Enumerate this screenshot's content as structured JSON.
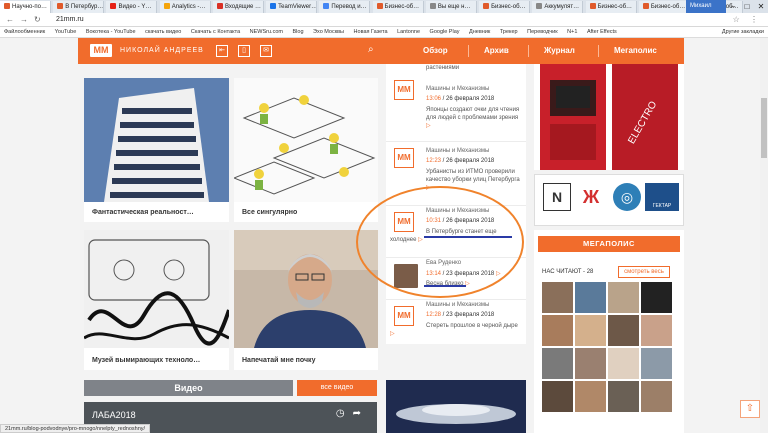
{
  "browser": {
    "tabs": [
      "Научно-по…",
      "В Петербур…",
      "Видео - Y…",
      "Analytics -…",
      "Входящие …",
      "TeamViewer…",
      "Перевод и…",
      "Бизнес-об…",
      "Вы еще н…",
      "Бизнес-об…",
      "Аккумулят…",
      "Бизнес-об…",
      "Бизнес-об…",
      "Бизнес-об…"
    ],
    "user": "Михаил",
    "url": "21mm.ru",
    "bookmarks": [
      "Файлообменник",
      "YouTube",
      "Вокотека - YouTube",
      "скачать видео",
      "Скачать с Контакта",
      "NEWSru.com",
      "Blog",
      "Эхо Москвы",
      "Новая Газета",
      "Lantonne",
      "Google Play",
      "Дневник",
      "Трекер",
      "Переводчик",
      "N+1",
      "After Effects"
    ],
    "other_bookmarks": "Другие закладки",
    "status": "21mm.ru/blog-podvodnye/pro-mnogo/nnelpty_rednoshny/"
  },
  "header": {
    "logo": "ММ",
    "author": "НИКОЛАЙ АНДРЕЕВ",
    "menu": [
      "Обзор",
      "Архив",
      "Журнал",
      "Мегаполис"
    ]
  },
  "cards": {
    "c1": "Фантастическая реальност…",
    "c2": "Все сингулярно",
    "c3": "Музей вымирающих техноло…",
    "c4": "Напечатай мне почку"
  },
  "feed": {
    "top_snip": "растениями",
    "items": [
      {
        "source": "Машины и Механизмы",
        "time": "13:06",
        "date": "26 февраля 2018",
        "title": "Японцы создают очки для чтения для людей с проблемами зрения"
      },
      {
        "source": "Машины и Механизмы",
        "time": "12:23",
        "date": "26 февраля 2018",
        "title": "Урбанисты из ИТМО проверили качество уборки улиц Петербурга"
      },
      {
        "source": "Машины и Механизмы",
        "time": "10:31",
        "date": "26 февраля 2018",
        "title": "В Петербурге станет еще холоднее"
      },
      {
        "source": "Ева Руденко",
        "time": "13:14",
        "date": "23 февраля 2018",
        "title": "Весна близко"
      },
      {
        "source": "Машины и Механизмы",
        "time": "12:28",
        "date": "23 февраля 2018",
        "title": "Стереть прошлое в черной дыре"
      }
    ]
  },
  "partners": [
    "N",
    "Ж",
    "◎",
    "ГЕКТАР"
  ],
  "megapolis": {
    "title": "МЕГАПОЛИС",
    "reading": "НАС ЧИТАЮТ - 28",
    "see_all": "смотреть весь"
  },
  "video": {
    "title": "Видео",
    "all": "все видео",
    "clip_title": "ЛАБА2018"
  },
  "colors": {
    "accent": "#f16c2c",
    "underline": "#2a3aa6",
    "circle": "#f0832c"
  }
}
